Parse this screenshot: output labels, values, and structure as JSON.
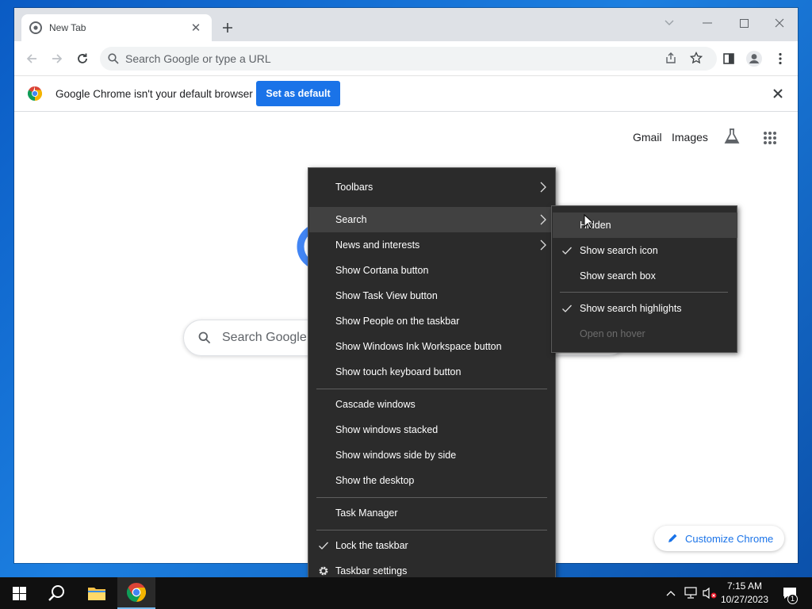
{
  "browser": {
    "tab_title": "New Tab",
    "omnibox_placeholder": "Search Google or type a URL",
    "infobar": {
      "message": "Google Chrome isn't your default browser",
      "button_label": "Set as default"
    },
    "newtab": {
      "links": [
        "Gmail",
        "Images"
      ],
      "search_placeholder": "Search Google",
      "customize_label": "Customize Chrome"
    }
  },
  "context_menu": {
    "items": [
      {
        "label": "Toolbars",
        "submenu": true
      },
      {
        "label": "Search",
        "submenu": true,
        "highlighted": true
      },
      {
        "label": "News and interests",
        "submenu": true
      },
      {
        "label": "Show Cortana button"
      },
      {
        "label": "Show Task View button"
      },
      {
        "label": "Show People on the taskbar"
      },
      {
        "label": "Show Windows Ink Workspace button"
      },
      {
        "label": "Show touch keyboard button"
      },
      {
        "label": "Cascade windows"
      },
      {
        "label": "Show windows stacked"
      },
      {
        "label": "Show windows side by side"
      },
      {
        "label": "Show the desktop"
      },
      {
        "label": "Task Manager"
      },
      {
        "label": "Lock the taskbar",
        "checked": true
      },
      {
        "label": "Taskbar settings",
        "icon": "gear-icon"
      }
    ]
  },
  "search_submenu": {
    "items": [
      {
        "label": "Hidden",
        "highlighted": true
      },
      {
        "label": "Show search icon",
        "checked": true
      },
      {
        "label": "Show search box"
      },
      {
        "label": "Show search highlights",
        "checked": true
      },
      {
        "label": "Open on hover",
        "disabled": true
      }
    ]
  },
  "taskbar": {
    "time": "7:15 AM",
    "date": "10/27/2023",
    "notification_count": "1"
  },
  "colors": {
    "accent": "#1a73e8",
    "menu_bg": "#2b2b2b",
    "taskbar_bg": "#101010"
  }
}
